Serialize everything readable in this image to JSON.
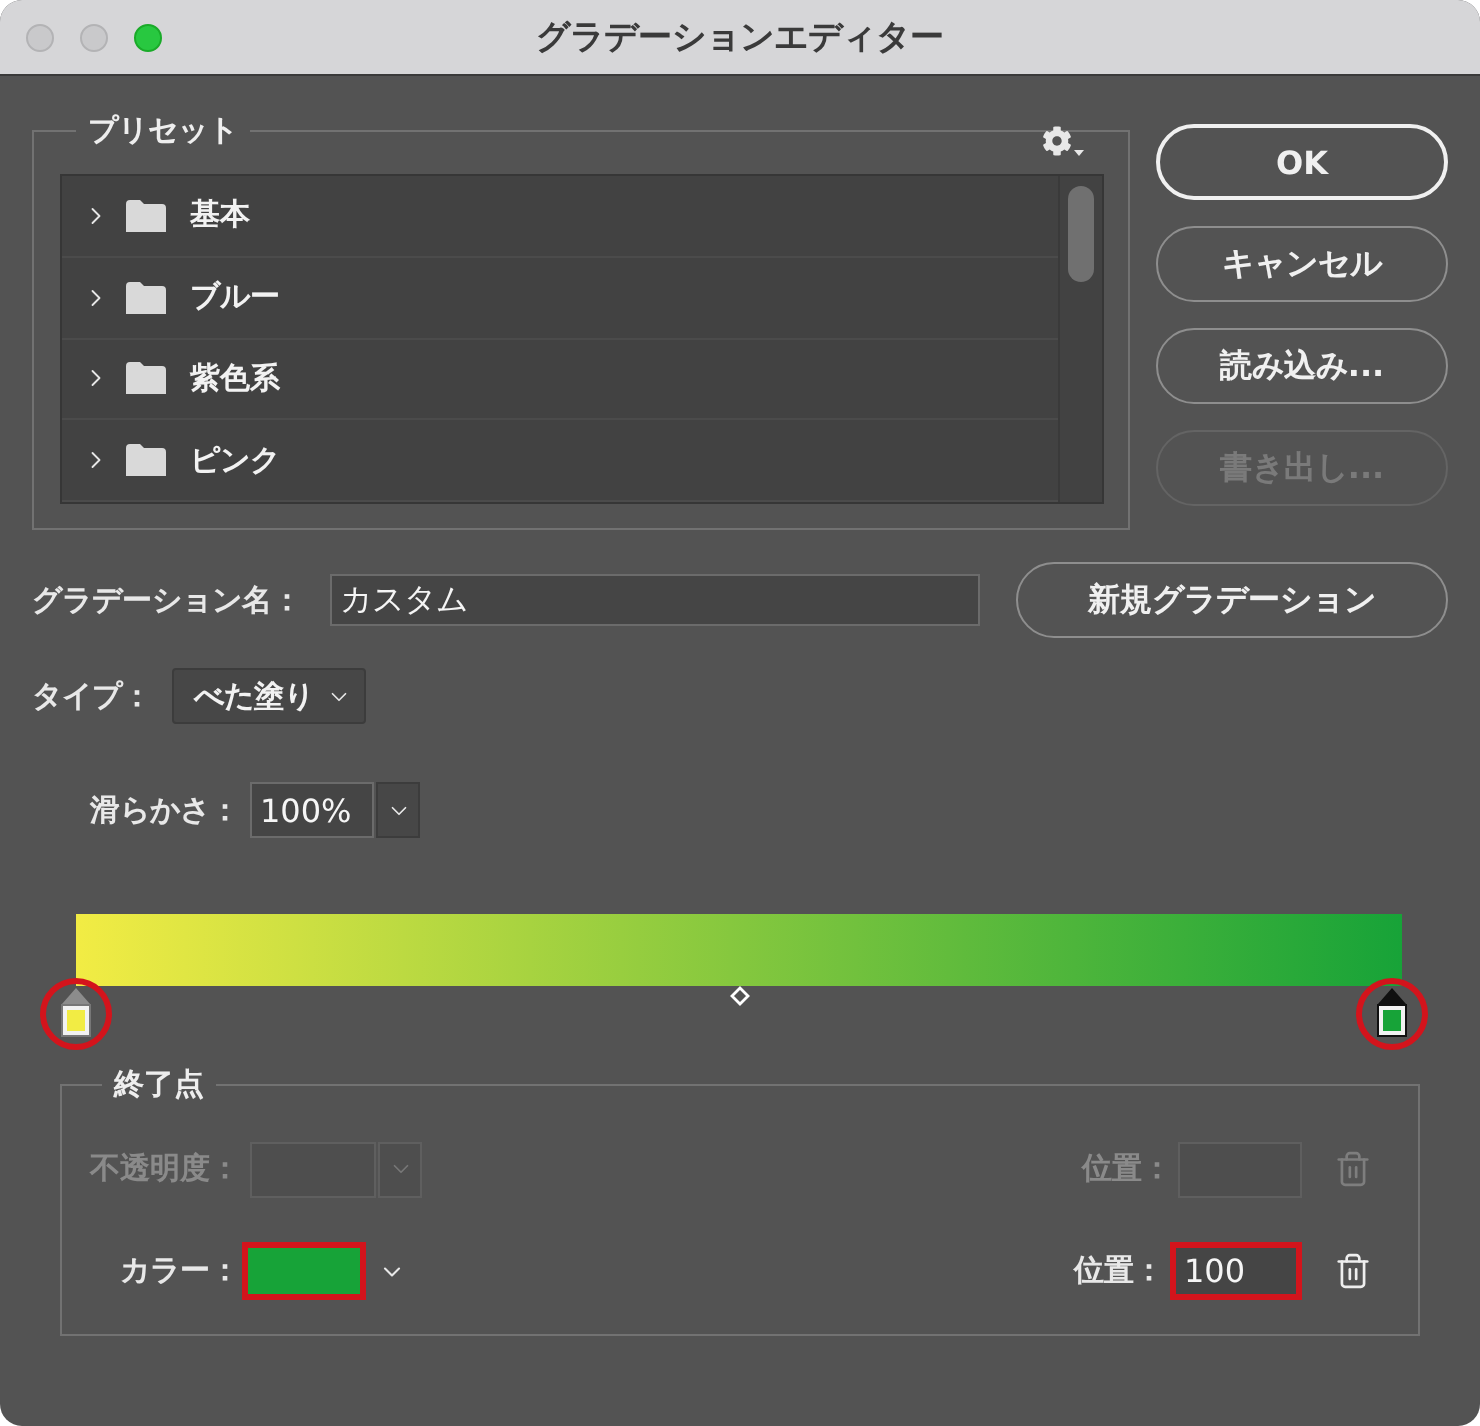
{
  "window": {
    "title": "グラデーションエディター",
    "controls": [
      {
        "kind": "close",
        "disabled": true
      },
      {
        "kind": "minimize",
        "disabled": true
      },
      {
        "kind": "zoom",
        "disabled": false
      }
    ]
  },
  "presets": {
    "label": "プリセット",
    "items": [
      {
        "name": "基本",
        "expanded": false
      },
      {
        "name": "ブルー",
        "expanded": false
      },
      {
        "name": "紫色系",
        "expanded": false
      },
      {
        "name": "ピンク",
        "expanded": false
      }
    ]
  },
  "buttons": [
    {
      "label": "OK",
      "default": true,
      "disabled": false
    },
    {
      "label": "キャンセル",
      "default": false,
      "disabled": false
    },
    {
      "label": "読み込み...",
      "default": false,
      "disabled": false
    },
    {
      "label": "書き出し...",
      "default": false,
      "disabled": true
    }
  ],
  "name_field": {
    "label": "グラデーション名：",
    "value": "カスタム"
  },
  "new_button": {
    "label": "新規グラデーション"
  },
  "type_select": {
    "label": "タイプ：",
    "value": "べた塗り"
  },
  "smoothness": {
    "label": "滑らかさ：",
    "value": "100%"
  },
  "gradient": {
    "stops": [
      {
        "color": "#f2ec44",
        "level": 0,
        "selected": false,
        "highlighted": true
      },
      {
        "color": "#17a338",
        "level": 1,
        "selected": true,
        "highlighted": true
      }
    ],
    "midpoint": {
      "level": 0.5
    }
  },
  "stop_settings": {
    "title": "終了点",
    "rows": [
      {
        "kind": "opacity",
        "label": "不透明度：",
        "disabled": true,
        "location_label": "位置：",
        "highlighted": false
      },
      {
        "kind": "color",
        "label": "カラー：",
        "disabled": false,
        "color": "#17a338",
        "location_label": "位置：",
        "location": "100",
        "highlighted": true
      }
    ]
  }
}
